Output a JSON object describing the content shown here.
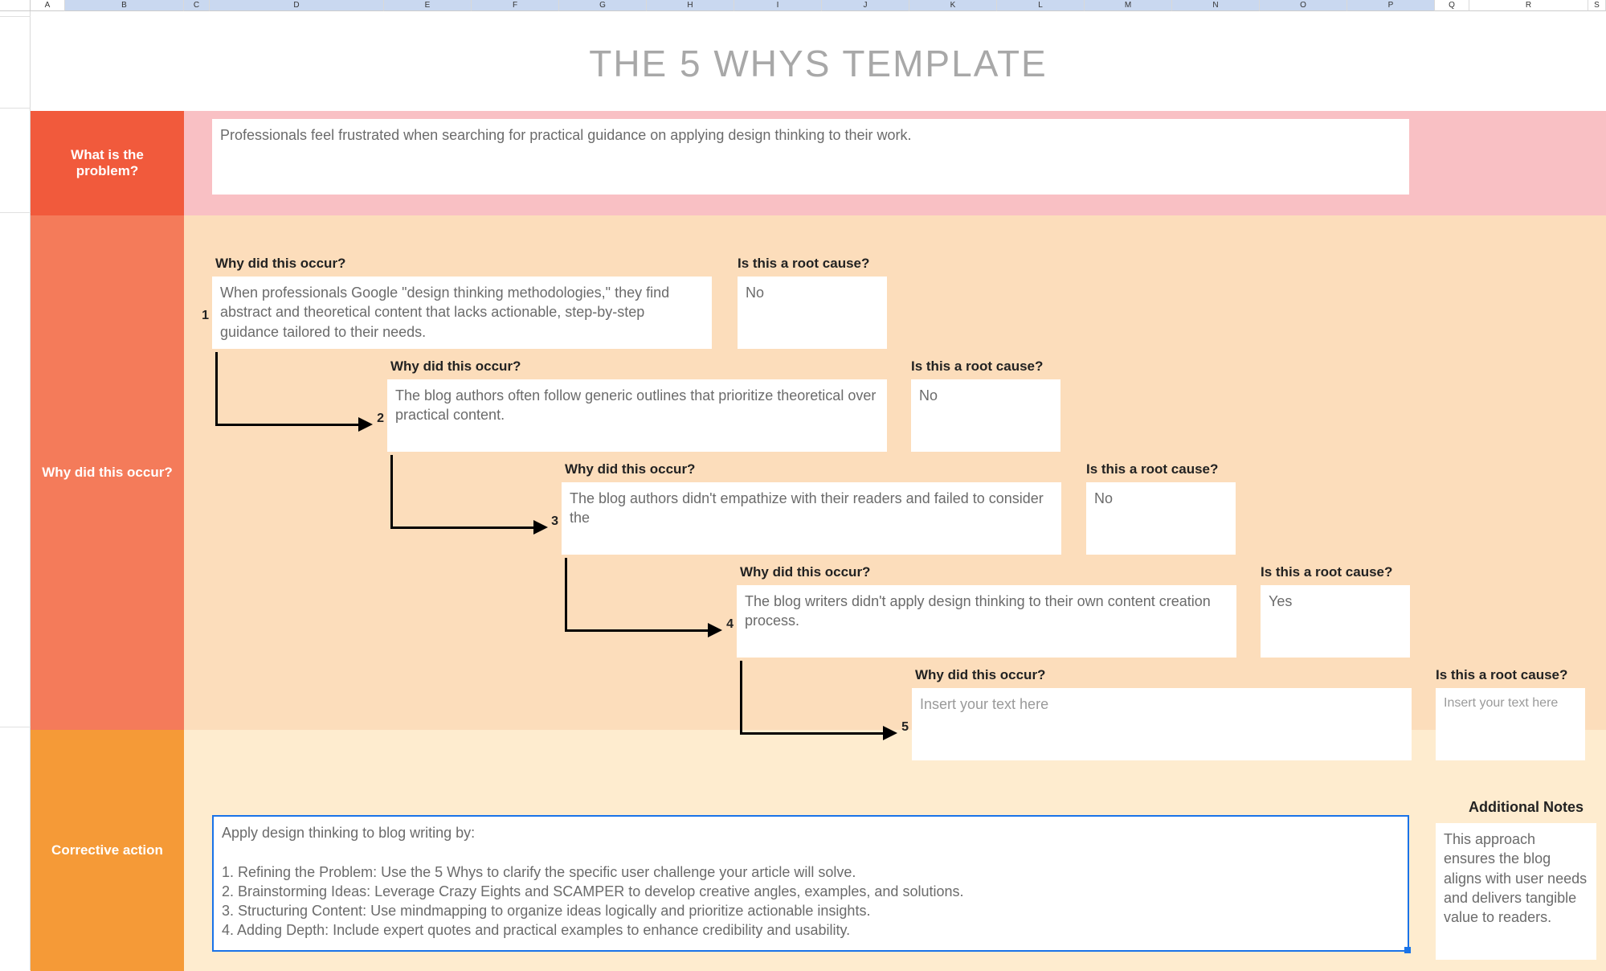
{
  "columns": [
    "A",
    "B",
    "C",
    "D",
    "E",
    "F",
    "G",
    "H",
    "I",
    "J",
    "K",
    "L",
    "M",
    "N",
    "O",
    "P",
    "Q",
    "R",
    "S"
  ],
  "title": "THE 5 WHYS TEMPLATE",
  "labels": {
    "problem": "What is the problem?",
    "whys": "Why did this occur?",
    "corrective": "Corrective action",
    "why_q": "Why did this occur?",
    "root_q": "Is this a root cause?",
    "notes_head": "Additional Notes"
  },
  "problem_text": "Professionals feel frustrated when searching for practical guidance on applying design thinking to their work.",
  "whys": [
    {
      "n": "1",
      "text": "When professionals Google \"design thinking methodologies,\" they find abstract and theoretical content that lacks actionable, step-by-step guidance tailored to their needs.",
      "root": "No"
    },
    {
      "n": "2",
      "text": "The blog authors often follow generic outlines that prioritize theoretical over practical content.",
      "root": "No"
    },
    {
      "n": "3",
      "text": "The blog authors didn't empathize with their readers and failed to consider the",
      "root": "No"
    },
    {
      "n": "4",
      "text": "The blog writers didn't apply design thinking to their own content creation process.",
      "root": "Yes"
    },
    {
      "n": "5",
      "text": "Insert your text here",
      "root": "Insert your text here"
    }
  ],
  "corrective_lines": [
    "Apply design thinking to blog writing by:",
    "",
    "1. Refining the Problem: Use the 5 Whys to clarify the specific user challenge your article will solve.",
    "2. Brainstorming Ideas: Leverage Crazy Eights and SCAMPER to develop creative angles, examples, and solutions.",
    "3. Structuring Content: Use mindmapping to organize ideas logically and prioritize actionable insights.",
    "4. Adding Depth: Include expert quotes and practical examples to enhance credibility and usability."
  ],
  "notes_text": "This approach ensures the blog aligns with user needs and delivers tangible value to readers."
}
